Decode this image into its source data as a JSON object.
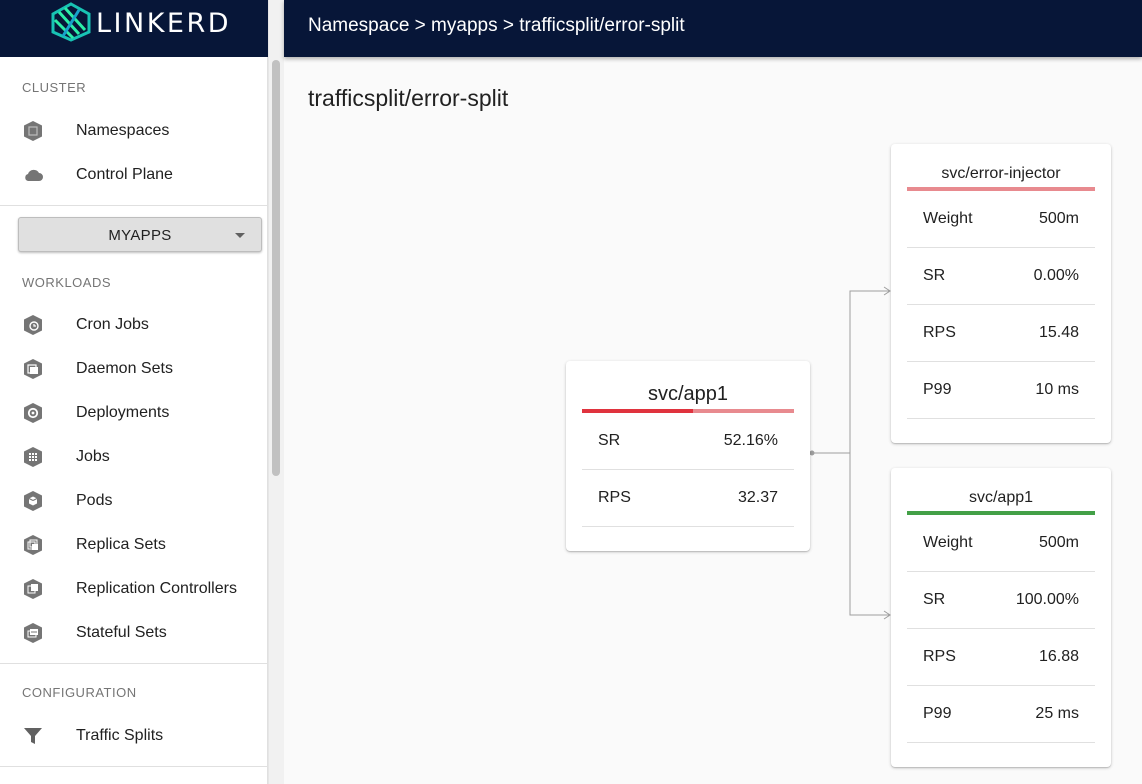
{
  "brand": {
    "name": "LINKERD"
  },
  "sidebar": {
    "cluster_label": "CLUSTER",
    "cluster_items": [
      {
        "label": "Namespaces",
        "icon": "namespace-icon"
      },
      {
        "label": "Control Plane",
        "icon": "cloud-icon"
      }
    ],
    "namespace_select": {
      "value": "MYAPPS"
    },
    "workloads_label": "WORKLOADS",
    "workload_items": [
      {
        "label": "Cron Jobs",
        "icon": "cronjob-icon"
      },
      {
        "label": "Daemon Sets",
        "icon": "daemonset-icon"
      },
      {
        "label": "Deployments",
        "icon": "deployment-icon"
      },
      {
        "label": "Jobs",
        "icon": "job-icon"
      },
      {
        "label": "Pods",
        "icon": "pod-icon"
      },
      {
        "label": "Replica Sets",
        "icon": "replicaset-icon"
      },
      {
        "label": "Replication Controllers",
        "icon": "replicationcontroller-icon"
      },
      {
        "label": "Stateful Sets",
        "icon": "statefulset-icon"
      }
    ],
    "configuration_label": "CONFIGURATION",
    "configuration_items": [
      {
        "label": "Traffic Splits",
        "icon": "filter-icon"
      }
    ]
  },
  "header": {
    "breadcrumb": {
      "part1": "Namespace",
      "sep1": " > ",
      "part2": "myapps",
      "sep2": " > ",
      "part3": "trafficsplit/error-split"
    }
  },
  "main": {
    "title": "trafficsplit/error-split",
    "source": {
      "name": "svc/app1",
      "success_fraction": 0.5216,
      "rows": [
        {
          "key": "SR",
          "value": "52.16%"
        },
        {
          "key": "RPS",
          "value": "32.37"
        }
      ]
    },
    "leaves": [
      {
        "name": "svc/error-injector",
        "status_color": "#e88a8f",
        "rows": [
          {
            "key": "Weight",
            "value": "500m"
          },
          {
            "key": "SR",
            "value": "0.00%"
          },
          {
            "key": "RPS",
            "value": "15.48"
          },
          {
            "key": "P99",
            "value": "10 ms"
          }
        ]
      },
      {
        "name": "svc/app1",
        "status_color": "#43a047",
        "rows": [
          {
            "key": "Weight",
            "value": "500m"
          },
          {
            "key": "SR",
            "value": "100.00%"
          },
          {
            "key": "RPS",
            "value": "16.88"
          },
          {
            "key": "P99",
            "value": "25 ms"
          }
        ]
      }
    ]
  },
  "colors": {
    "navy": "#071638",
    "error_red": "#e0333e",
    "error_light": "#e88a8f",
    "success_green": "#43a047"
  }
}
